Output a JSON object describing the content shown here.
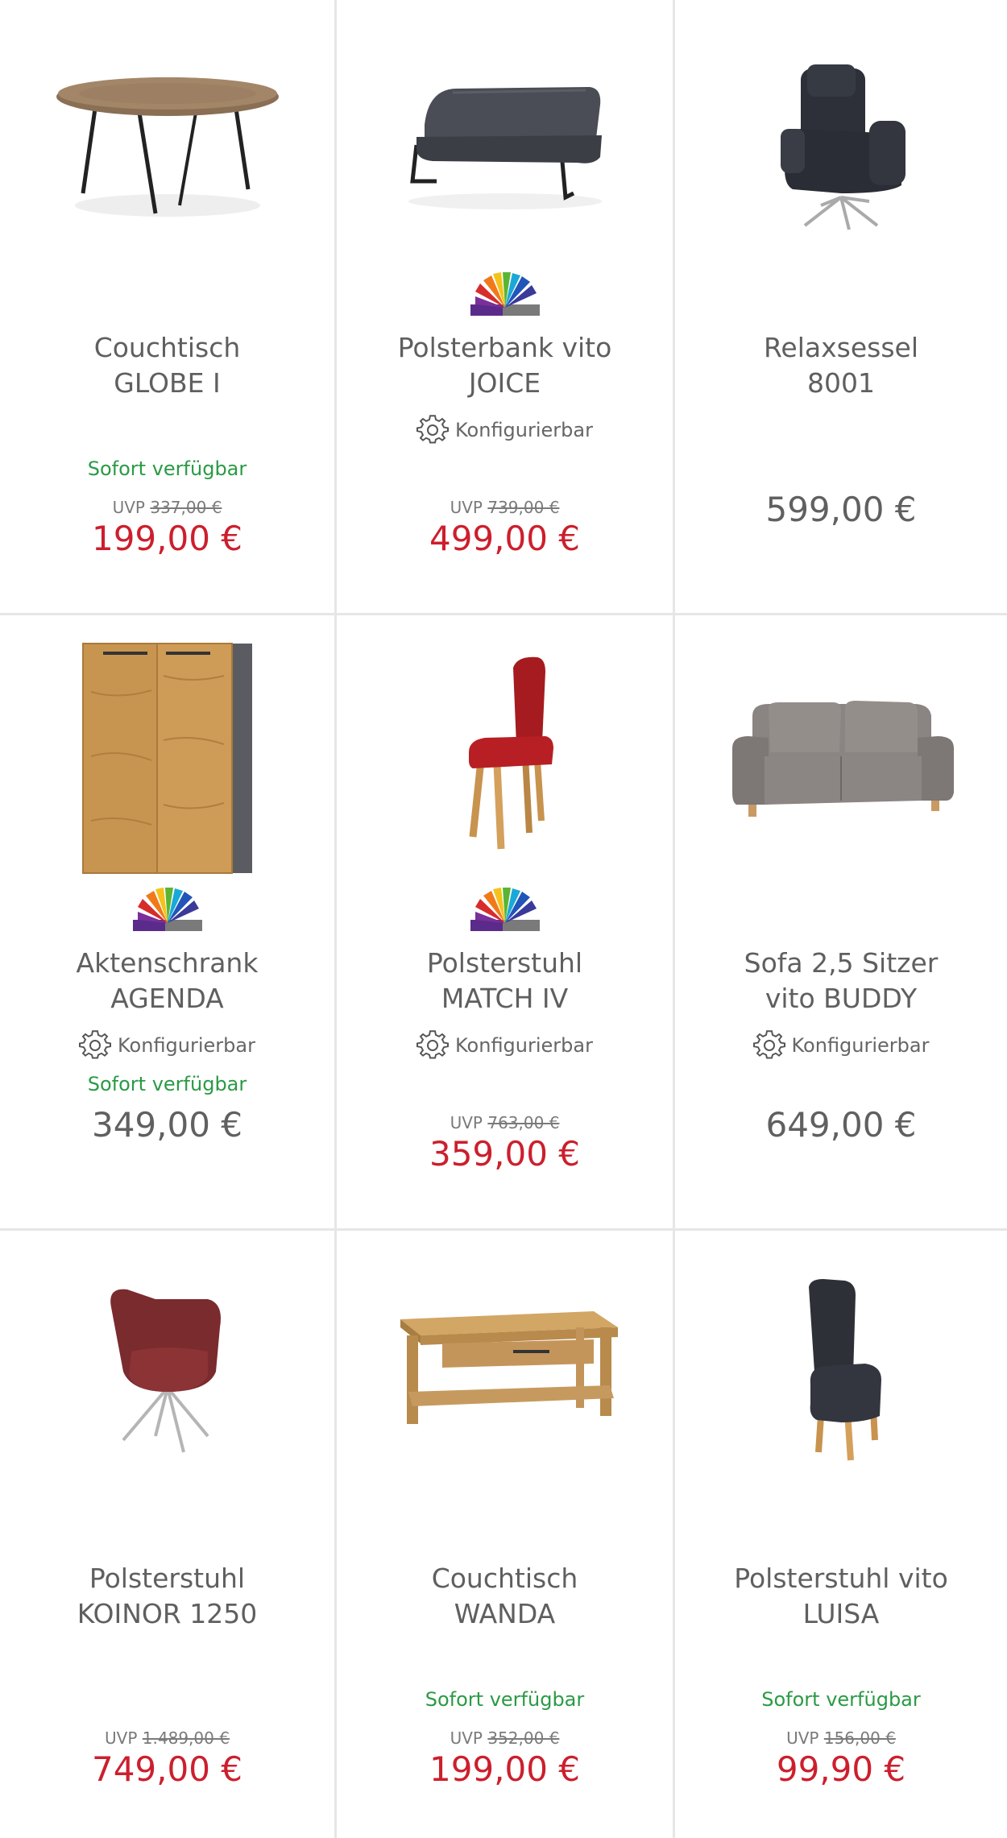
{
  "colors": {
    "sale_price": "#cc1f2d",
    "regular_price": "#606060",
    "availability": "#2a9a45",
    "title": "#5f5f5f"
  },
  "products": [
    {
      "title1": "Couchtisch",
      "title2": "GLOBE I",
      "availability": "Sofort verfügbar",
      "uvp_label": "UVP",
      "uvp_price": "337,00 €",
      "price": "199,00 €",
      "image": "round-coffee-table"
    },
    {
      "title1": "Polsterbank vito",
      "title2": "JOICE",
      "configurable": "Konfigurierbar",
      "uvp_label": "UVP",
      "uvp_price": "739,00 €",
      "price": "499,00 €",
      "image": "upholstered-bench",
      "badge": "color-choice-badge"
    },
    {
      "title1": "Relaxsessel",
      "title2": "8001",
      "price": "599,00 €",
      "image": "recliner-armchair"
    },
    {
      "title1": "Aktenschrank",
      "title2": "AGENDA",
      "configurable": "Konfigurierbar",
      "availability": "Sofort verfügbar",
      "price": "349,00 €",
      "image": "file-cabinet",
      "badge": "color-choice-badge"
    },
    {
      "title1": "Polsterstuhl",
      "title2": "MATCH IV",
      "configurable": "Konfigurierbar",
      "uvp_label": "UVP",
      "uvp_price": "763,00 €",
      "price": "359,00 €",
      "image": "red-dining-chair",
      "badge": "color-choice-badge"
    },
    {
      "title1": "Sofa 2,5 Sitzer",
      "title2": "vito BUDDY",
      "configurable": "Konfigurierbar",
      "price": "649,00 €",
      "image": "grey-sofa"
    },
    {
      "title1": "Polsterstuhl",
      "title2": "KOINOR 1250",
      "uvp_label": "UVP",
      "uvp_price": "1.489,00 €",
      "price": "749,00 €",
      "image": "leather-swivel-chair"
    },
    {
      "title1": "Couchtisch",
      "title2": "WANDA",
      "availability": "Sofort verfügbar",
      "uvp_label": "UVP",
      "uvp_price": "352,00 €",
      "price": "199,00 €",
      "image": "wooden-coffee-table"
    },
    {
      "title1": "Polsterstuhl vito",
      "title2": "LUISA",
      "availability": "Sofort verfügbar",
      "uvp_label": "UVP",
      "uvp_price": "156,00 €",
      "price": "99,90 €",
      "image": "high-back-chair"
    }
  ]
}
